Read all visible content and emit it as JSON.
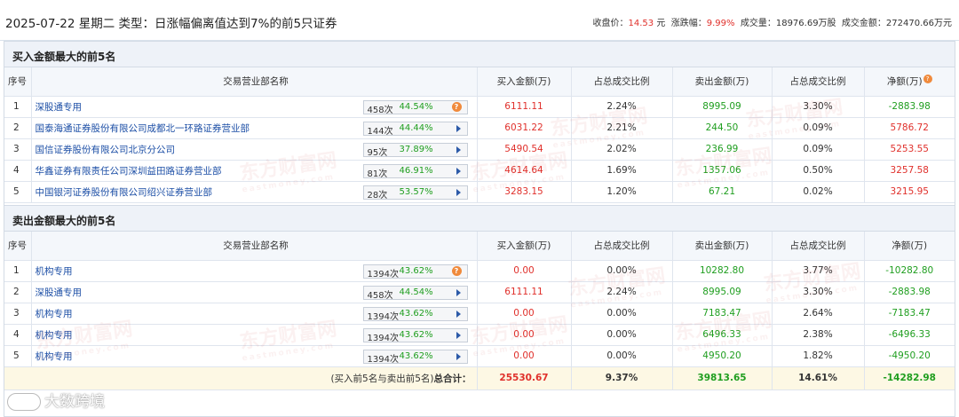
{
  "header": {
    "title": "2025-07-22 星期二 类型：日涨幅偏离值达到7%的前5只证券",
    "close_label": "收盘价：",
    "close_value": "14.53",
    "close_unit": "元",
    "change_label": "涨跌幅：",
    "change_value": "9.99%",
    "volume_label": "成交量：",
    "volume_value": "18976.69万股",
    "amount_label": "成交金额：",
    "amount_value": "272470.66万元"
  },
  "columns": {
    "seq": "序号",
    "name": "交易营业部名称",
    "buy": "买入金额(万)",
    "buy_ratio": "占总成交比例",
    "sell": "卖出金额(万)",
    "sell_ratio": "占总成交比例",
    "net": "净额(万)"
  },
  "buy_section": {
    "title": "买入金额最大的前5名",
    "rows": [
      {
        "seq": "1",
        "name": "深股通专用",
        "count": "458次",
        "rate": "44.54%",
        "icon": "question",
        "buy": "6111.11",
        "buy_ratio": "2.24%",
        "sell": "8995.09",
        "sell_ratio": "3.30%",
        "net": "-2883.98",
        "net_color": "green"
      },
      {
        "seq": "2",
        "name": "国泰海通证券股份有限公司成都北一环路证券营业部",
        "count": "144次",
        "rate": "44.44%",
        "icon": "arrow",
        "buy": "6031.22",
        "buy_ratio": "2.21%",
        "sell": "244.50",
        "sell_ratio": "0.09%",
        "net": "5786.72",
        "net_color": "red"
      },
      {
        "seq": "3",
        "name": "国信证券股份有限公司北京分公司",
        "count": "95次",
        "rate": "37.89%",
        "icon": "arrow",
        "buy": "5490.54",
        "buy_ratio": "2.02%",
        "sell": "236.99",
        "sell_ratio": "0.09%",
        "net": "5253.55",
        "net_color": "red"
      },
      {
        "seq": "4",
        "name": "华鑫证券有限责任公司深圳益田路证券营业部",
        "count": "81次",
        "rate": "46.91%",
        "icon": "arrow",
        "buy": "4614.64",
        "buy_ratio": "1.69%",
        "sell": "1357.06",
        "sell_ratio": "0.50%",
        "net": "3257.58",
        "net_color": "red"
      },
      {
        "seq": "5",
        "name": "中国银河证券股份有限公司绍兴证券营业部",
        "count": "28次",
        "rate": "53.57%",
        "icon": "arrow",
        "buy": "3283.15",
        "buy_ratio": "1.20%",
        "sell": "67.21",
        "sell_ratio": "0.02%",
        "net": "3215.95",
        "net_color": "red"
      }
    ]
  },
  "sell_section": {
    "title": "卖出金额最大的前5名",
    "rows": [
      {
        "seq": "1",
        "name": "机构专用",
        "count": "1394次",
        "rate": "43.62%",
        "icon": "question",
        "buy": "0.00",
        "buy_ratio": "0.00%",
        "sell": "10282.80",
        "sell_ratio": "3.77%",
        "net": "-10282.80",
        "net_color": "green"
      },
      {
        "seq": "2",
        "name": "深股通专用",
        "count": "458次",
        "rate": "44.54%",
        "icon": "arrow",
        "buy": "6111.11",
        "buy_ratio": "2.24%",
        "sell": "8995.09",
        "sell_ratio": "3.30%",
        "net": "-2883.98",
        "net_color": "green"
      },
      {
        "seq": "3",
        "name": "机构专用",
        "count": "1394次",
        "rate": "43.62%",
        "icon": "arrow",
        "buy": "0.00",
        "buy_ratio": "0.00%",
        "sell": "7183.47",
        "sell_ratio": "2.64%",
        "net": "-7183.47",
        "net_color": "green"
      },
      {
        "seq": "4",
        "name": "机构专用",
        "count": "1394次",
        "rate": "43.62%",
        "icon": "arrow",
        "buy": "0.00",
        "buy_ratio": "0.00%",
        "sell": "6496.33",
        "sell_ratio": "2.38%",
        "net": "-6496.33",
        "net_color": "green"
      },
      {
        "seq": "5",
        "name": "机构专用",
        "count": "1394次",
        "rate": "43.62%",
        "icon": "arrow",
        "buy": "0.00",
        "buy_ratio": "0.00%",
        "sell": "4950.20",
        "sell_ratio": "1.82%",
        "net": "-4950.20",
        "net_color": "green"
      }
    ]
  },
  "total": {
    "label_prefix": "(买入前5名与卖出前5名)",
    "label_bold": "总合计：",
    "buy": "25530.67",
    "buy_ratio": "9.37%",
    "sell": "39813.65",
    "sell_ratio": "14.61%",
    "net": "-14282.98"
  },
  "watermark": {
    "text": "东方财富网",
    "sub": "eastmoney.com"
  },
  "brand": {
    "name": "大数跨境"
  },
  "colors": {
    "up": "#e0302b",
    "down": "#1f9e1f",
    "link": "#1d4fa6",
    "header_bg": "#eef2f8",
    "total_bg": "#fdf8e4"
  }
}
